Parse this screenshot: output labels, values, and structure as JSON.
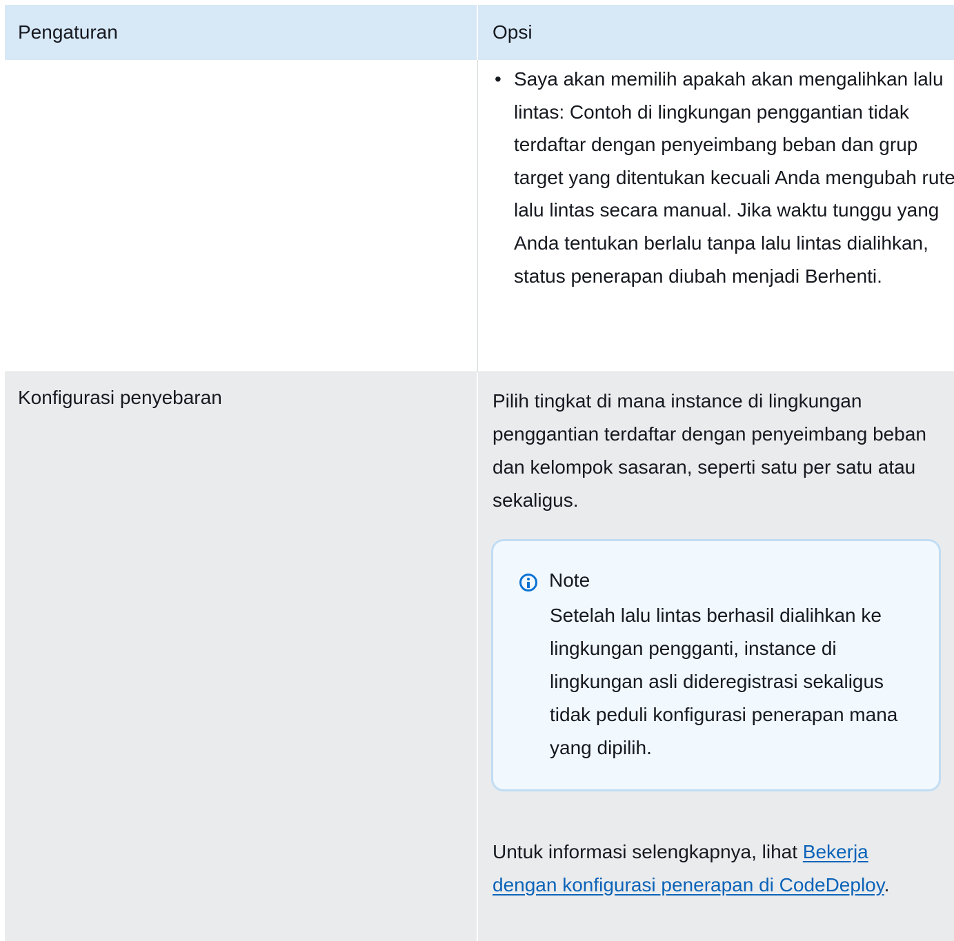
{
  "header": {
    "col1": "Pengaturan",
    "col2": "Opsi"
  },
  "row1": {
    "setting": "",
    "bullet": "Saya akan memilih apakah akan mengalihkan lalu lintas: Contoh di lingkungan penggantian tidak terdaftar dengan penyeimbang beban dan grup target yang ditentukan kecuali Anda mengubah rute lalu lintas secara manual. Jika waktu tunggu yang Anda tentukan berlalu tanpa lalu lintas dialihkan, status penerapan diubah menjadi Berhenti."
  },
  "row2": {
    "setting": "Konfigurasi penyebaran",
    "description": "Pilih tingkat di mana instance di lingkungan penggantian terdaftar dengan penyeimbang beban dan kelompok sasaran, seperti satu per satu atau sekaligus.",
    "note": {
      "icon": "info-icon",
      "title": "Note",
      "body": "Setelah lalu lintas berhasil dialihkan ke lingkungan pengganti, instance di lingkungan asli dideregistrasi sekaligus tidak peduli konfigurasi penerapan mana yang dipilih."
    },
    "more_info": {
      "prefix": "Untuk informasi selengkapnya, lihat ",
      "link_text": "Bekerja dengan konfigurasi penerapan di CodeDeploy",
      "suffix": "."
    }
  },
  "colors": {
    "header_bg": "#d7e8f7",
    "row_alt_bg": "#e9ebed",
    "note_bg": "#f1f8fe",
    "note_border": "#c1ddf4",
    "link": "#0b63b8",
    "icon": "#0972d3"
  }
}
